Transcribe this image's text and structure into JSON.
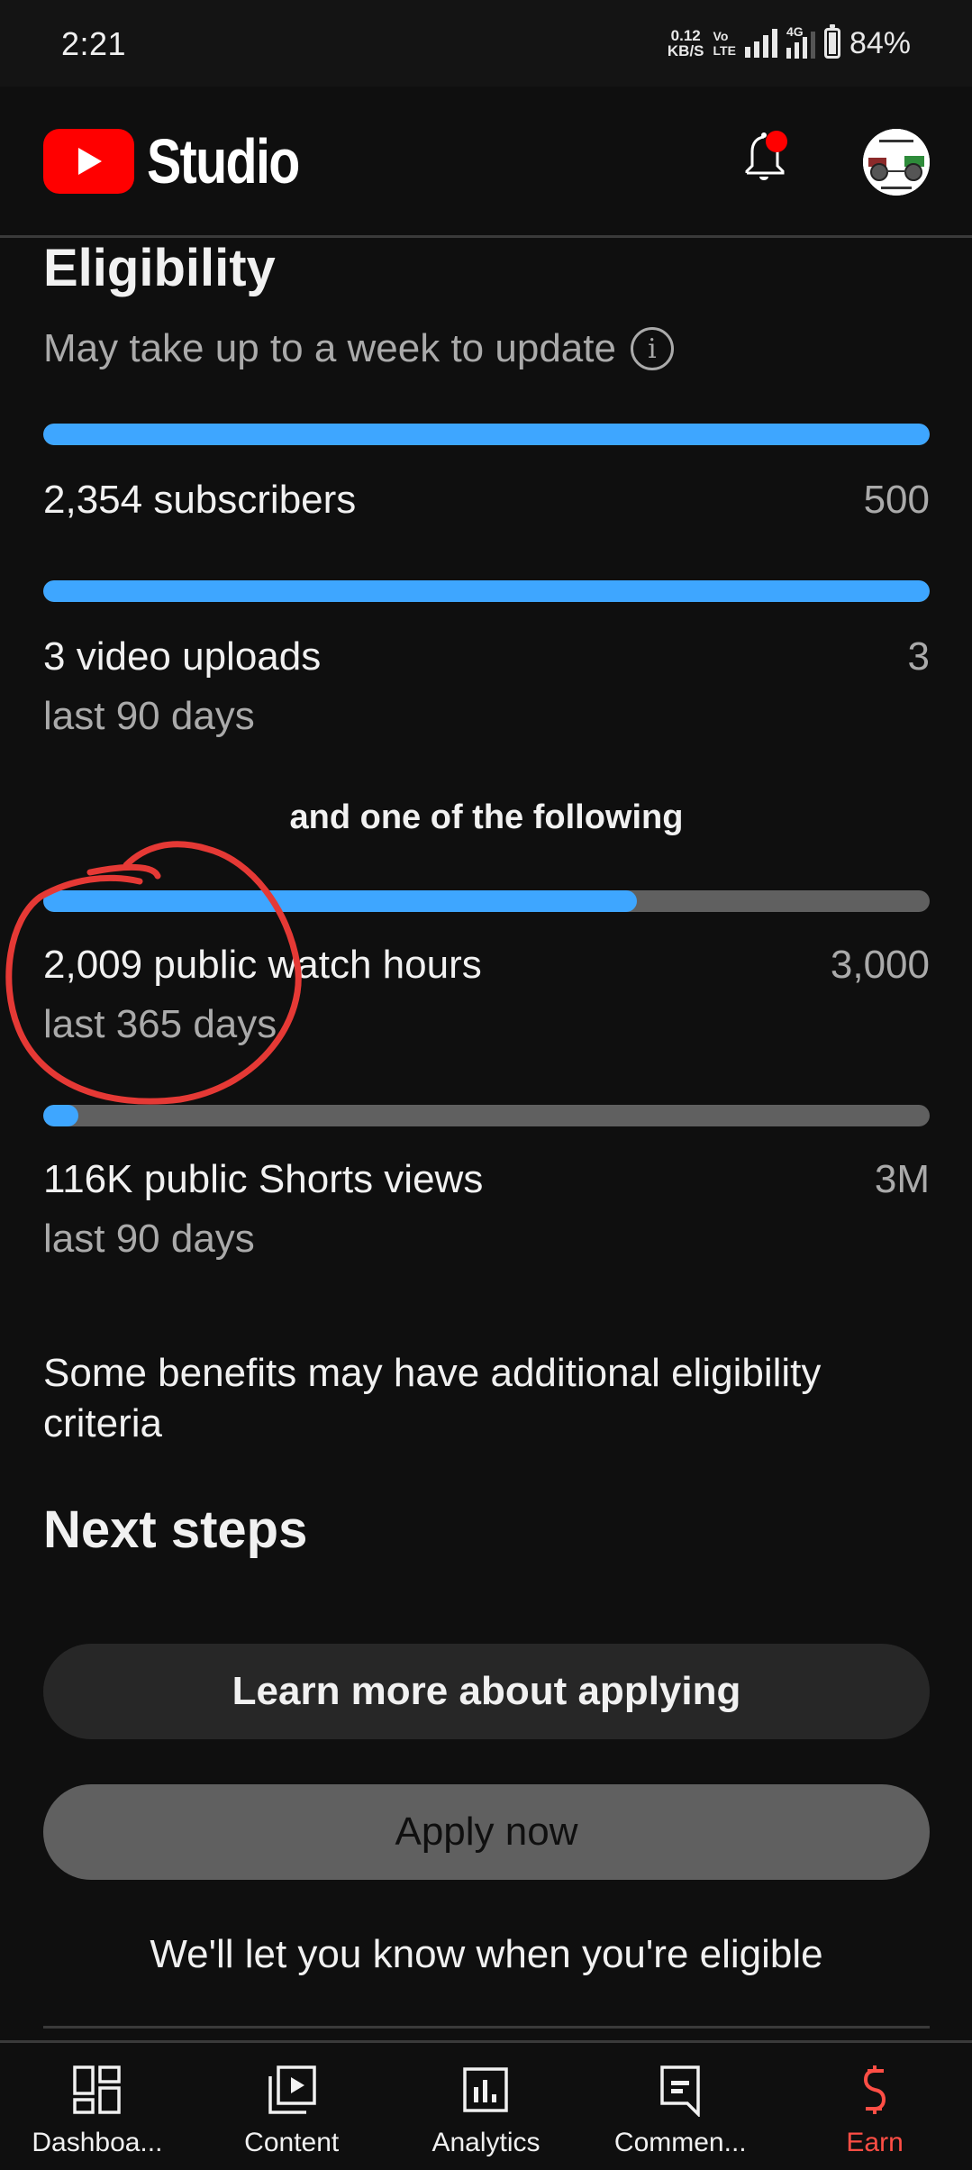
{
  "status_bar": {
    "time": "2:21",
    "net_speed_value": "0.12",
    "net_speed_unit": "KB/S",
    "volte_top": "Vo",
    "volte_bottom": "LTE",
    "network_type": "4G",
    "battery_percent_text": "84%",
    "battery_level": 0.84
  },
  "header": {
    "app_name": "Studio",
    "notification_badge": true,
    "brand_color": "#ff0000",
    "avatar_alt": "Channel avatar"
  },
  "eligibility": {
    "title": "Eligibility",
    "subtitle": "May take up to a week to update",
    "info_icon_glyph": "i",
    "requirements": [
      {
        "label": "2,354 subscribers",
        "target": "500",
        "sublabel": "",
        "progress": 1.0
      },
      {
        "label": "3 video uploads",
        "target": "3",
        "sublabel": "last 90 days",
        "progress": 1.0
      }
    ],
    "or_label": "and one of the following",
    "alternatives": [
      {
        "label": "2,009 public watch hours",
        "target": "3,000",
        "sublabel": "last 365 days",
        "progress": 0.67
      },
      {
        "label": "116K public Shorts views",
        "target": "3M",
        "sublabel": "last 90 days",
        "progress": 0.039
      }
    ],
    "note": "Some benefits may have additional eligibility criteria"
  },
  "next_steps": {
    "title": "Next steps",
    "learn_more_label": "Learn more about applying",
    "apply_label": "Apply now",
    "eligible_note": "We'll let you know when you're eligible"
  },
  "bottom_nav": {
    "items": [
      {
        "label": "Dashboa...",
        "icon": "dashboard-icon",
        "active": false
      },
      {
        "label": "Content",
        "icon": "content-icon",
        "active": false
      },
      {
        "label": "Analytics",
        "icon": "analytics-icon",
        "active": false
      },
      {
        "label": "Commen...",
        "icon": "comments-icon",
        "active": false
      },
      {
        "label": "Earn",
        "icon": "dollar-icon",
        "active": true
      }
    ],
    "active_color": "#ff4e45"
  },
  "colors": {
    "progress_fill": "#3ea6ff",
    "progress_track": "#606060",
    "annotation": "#e53935"
  }
}
